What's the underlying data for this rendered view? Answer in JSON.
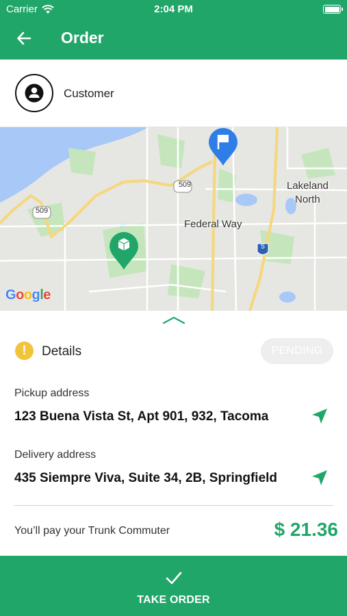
{
  "status_bar": {
    "carrier": "Carrier",
    "time": "2:04 PM"
  },
  "app_bar": {
    "title": "Order",
    "back_icon": "arrow-back-icon"
  },
  "customer": {
    "name": "Customer",
    "icon": "person-icon"
  },
  "map": {
    "labels": {
      "city": "Federal Way",
      "lakeland_1": "Lakeland",
      "lakeland_2": "North",
      "route_509_a": "509",
      "route_509_b": "509",
      "interstate": "5"
    },
    "attribution": [
      "G",
      "o",
      "o",
      "g",
      "l",
      "e"
    ],
    "colors": {
      "water": "#a8c8f8",
      "park": "#c5e6bd",
      "road": "#f6d77a",
      "pickup_pin": "#21a66a",
      "dest_pin": "#2f7ee8"
    }
  },
  "details": {
    "label": "Details",
    "status": "PENDING",
    "pickup_label": "Pickup address",
    "pickup_value": "123 Buena Vista St, Apt 901, 932, Tacoma",
    "delivery_label": "Delivery address",
    "delivery_value": "435 Siempre Viva, Suite 34, 2B, Springfield"
  },
  "payment": {
    "label": "You’ll pay your Trunk Commuter",
    "amount": "$ 21.36"
  },
  "action": {
    "label": "TAKE ORDER"
  },
  "colors": {
    "primary": "#21a66a",
    "warning": "#f2c43b"
  }
}
